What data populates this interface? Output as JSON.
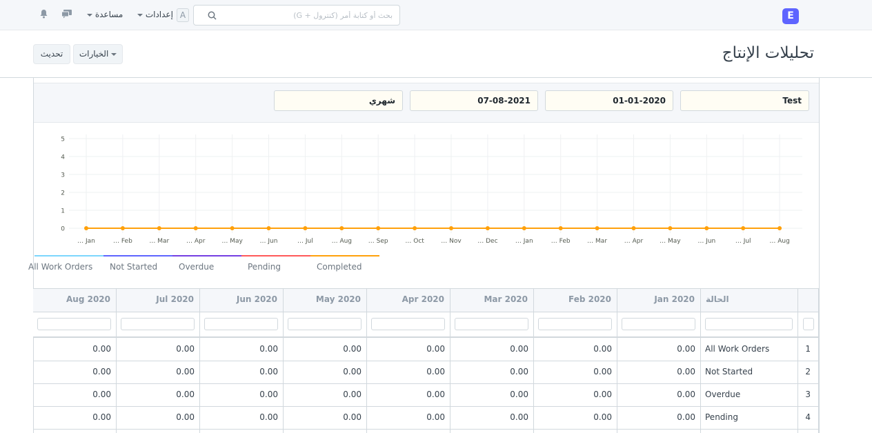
{
  "navbar": {
    "search_placeholder": "بحث أو كتابة أمر (كنترول + G)",
    "settings_label": "إعدادات",
    "help_label": "مساعدة",
    "avatar_letter": "A",
    "logo_letter": "E"
  },
  "page": {
    "title": "تحليلات الإنتاج",
    "options_label": "الخيارات",
    "refresh_label": "تحديث"
  },
  "filters": {
    "company": "Test",
    "from_date": "01-01-2020",
    "to_date": "07-08-2021",
    "range": "شهري"
  },
  "chart_data": {
    "type": "line",
    "categories": [
      "Jan",
      "Feb",
      "Mar",
      "Apr",
      "May",
      "Jun",
      "Jul",
      "Aug",
      "Sep",
      "Oct",
      "Nov",
      "Dec",
      "Jan",
      "Feb",
      "Mar",
      "Apr",
      "May",
      "Jun",
      "Jul",
      "Aug"
    ],
    "yticks": [
      "0",
      "1",
      "2",
      "3",
      "4",
      "5"
    ],
    "ylim": [
      0,
      5
    ],
    "series": [
      {
        "name": "All Work Orders",
        "color": "#7cd6fd",
        "values": [
          0,
          0,
          0,
          0,
          0,
          0,
          0,
          0,
          0,
          0,
          0,
          0,
          0,
          0,
          0,
          0,
          0,
          0,
          0,
          0
        ]
      },
      {
        "name": "Not Started",
        "color": "#5e64ff",
        "values": [
          0,
          0,
          0,
          0,
          0,
          0,
          0,
          0,
          0,
          0,
          0,
          0,
          0,
          0,
          0,
          0,
          0,
          0,
          0,
          0
        ]
      },
      {
        "name": "Overdue",
        "color": "#743ee2",
        "values": [
          0,
          0,
          0,
          0,
          0,
          0,
          0,
          0,
          0,
          0,
          0,
          0,
          0,
          0,
          0,
          0,
          0,
          0,
          0,
          0
        ]
      },
      {
        "name": "Pending",
        "color": "#ff5858",
        "values": [
          0,
          0,
          0,
          0,
          0,
          0,
          0,
          0,
          0,
          0,
          0,
          0,
          0,
          0,
          0,
          0,
          0,
          0,
          0,
          0
        ]
      },
      {
        "name": "Completed",
        "color": "#ffa00a",
        "values": [
          0,
          0,
          0,
          0,
          0,
          0,
          0,
          0,
          0,
          0,
          0,
          0,
          0,
          0,
          0,
          0,
          0,
          0,
          0,
          0
        ]
      }
    ],
    "legend_labels": [
      "All Work Orders",
      "Not Started",
      "Overdue",
      "Pending",
      "Completed"
    ],
    "grid": true
  },
  "table": {
    "status_header": "الحالة",
    "month_headers": [
      "Jan 2020",
      "Feb 2020",
      "Mar 2020",
      "Apr 2020",
      "May 2020",
      "Jun 2020",
      "Jul 2020",
      "Aug 2020"
    ],
    "rows": [
      {
        "index": "1",
        "status": "All Work Orders",
        "values": [
          "0.00",
          "0.00",
          "0.00",
          "0.00",
          "0.00",
          "0.00",
          "0.00",
          "0.00"
        ]
      },
      {
        "index": "2",
        "status": "Not Started",
        "values": [
          "0.00",
          "0.00",
          "0.00",
          "0.00",
          "0.00",
          "0.00",
          "0.00",
          "0.00"
        ]
      },
      {
        "index": "3",
        "status": "Overdue",
        "values": [
          "0.00",
          "0.00",
          "0.00",
          "0.00",
          "0.00",
          "0.00",
          "0.00",
          "0.00"
        ]
      },
      {
        "index": "4",
        "status": "Pending",
        "values": [
          "0.00",
          "0.00",
          "0.00",
          "0.00",
          "0.00",
          "0.00",
          "0.00",
          "0.00"
        ]
      }
    ]
  },
  "icons": {
    "bell": "bell-icon",
    "chat": "chat-icon",
    "search": "search-icon"
  }
}
